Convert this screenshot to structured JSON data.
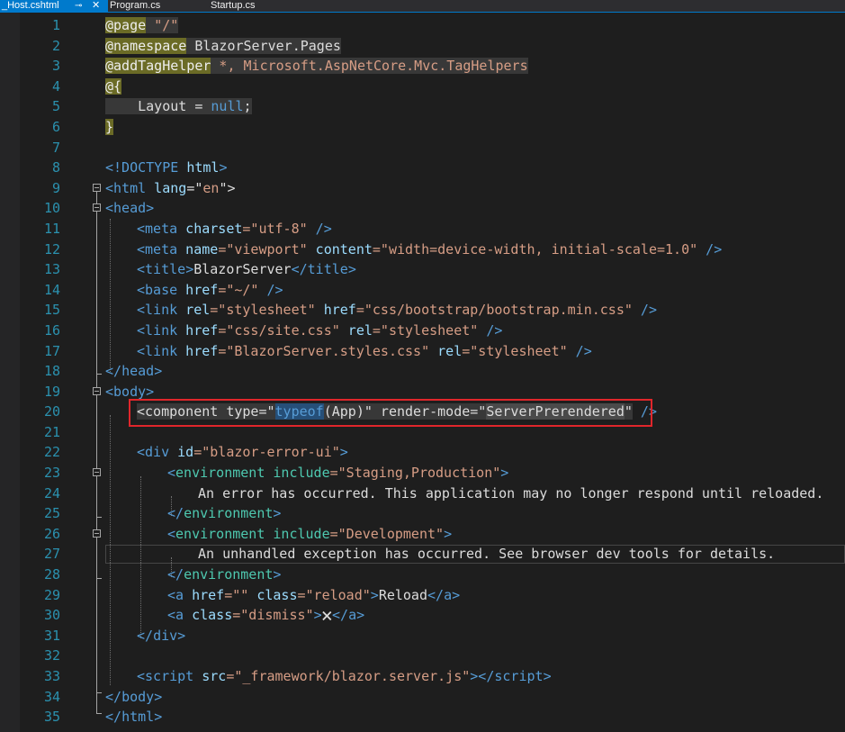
{
  "tabs": [
    {
      "label": "_Host.cshtml",
      "active": true
    },
    {
      "label": "Program.cs",
      "active": false
    },
    {
      "label": "Startup.cs",
      "active": false
    }
  ],
  "icons": {
    "pin": "pin-icon",
    "close": "close-icon"
  },
  "lines": {
    "l1": {
      "n": "1",
      "a": "@page",
      "b": " ",
      "c": "\"/\""
    },
    "l2": {
      "n": "2",
      "a": "@namespace",
      "b": " BlazorServer.Pages"
    },
    "l3": {
      "n": "3",
      "a": "@addTagHelper",
      "b": " *, Microsoft.AspNetCore.Mvc.TagHelpers"
    },
    "l4": {
      "n": "4",
      "a": "@{"
    },
    "l5": {
      "n": "5",
      "a": "    Layout = ",
      "b": "null",
      "c": ";"
    },
    "l6": {
      "n": "6",
      "a": "}"
    },
    "l7": {
      "n": "7"
    },
    "l8": {
      "n": "8",
      "a": "<!DOCTYPE ",
      "b": "html",
      "c": ">"
    },
    "l9": {
      "n": "9",
      "a": "<",
      "b": "html",
      "c": " lang",
      "d": "=\"",
      "e": "en",
      "f": "\">"
    },
    "l10": {
      "n": "10",
      "a": "<",
      "b": "head",
      "c": ">"
    },
    "l11": {
      "n": "11",
      "a": "<",
      "b": "meta",
      "c": " charset",
      "d": "=\"utf-8\"",
      "e": " />"
    },
    "l12": {
      "n": "12",
      "a": "<",
      "b": "meta",
      "c": " name",
      "d": "=\"viewport\"",
      "e": " content",
      "f": "=\"width=device-width, initial-scale=1.0\"",
      "g": " />"
    },
    "l13": {
      "n": "13",
      "a": "<",
      "b": "title",
      "c": ">",
      "d": "BlazorServer",
      "e": "</",
      "f": "title",
      "g": ">"
    },
    "l14": {
      "n": "14",
      "a": "<",
      "b": "base",
      "c": " href",
      "d": "=\"~/\"",
      "e": " />"
    },
    "l15": {
      "n": "15",
      "a": "<",
      "b": "link",
      "c": " rel",
      "d": "=\"stylesheet\"",
      "e": " href",
      "f": "=\"css/bootstrap/bootstrap.min.css\"",
      "g": " />"
    },
    "l16": {
      "n": "16",
      "a": "<",
      "b": "link",
      "c": " href",
      "d": "=\"css/site.css\"",
      "e": " rel",
      "f": "=\"stylesheet\"",
      "g": " />"
    },
    "l17": {
      "n": "17",
      "a": "<",
      "b": "link",
      "c": " href",
      "d": "=\"BlazorServer.styles.css\"",
      "e": " rel",
      "f": "=\"stylesheet\"",
      "g": " />"
    },
    "l18": {
      "n": "18",
      "a": "</",
      "b": "head",
      "c": ">"
    },
    "l19": {
      "n": "19",
      "a": "<",
      "b": "body",
      "c": ">"
    },
    "l20": {
      "n": "20",
      "a": "<",
      "b": "component",
      "c": " type",
      "d": "=\"",
      "e": "typeof",
      "f": "(",
      "g": "App",
      "h": ")",
      "i": "\"",
      "j": " render-mode",
      "k": "=\"",
      "l": "ServerPrerendered",
      "m": "\"",
      "n2": " />"
    },
    "l21": {
      "n": "21"
    },
    "l22": {
      "n": "22",
      "a": "<",
      "b": "div",
      "c": " id",
      "d": "=\"blazor-error-ui\"",
      "e": ">"
    },
    "l23": {
      "n": "23",
      "a": "<",
      "b": "environment",
      "c": " include",
      "d": "=\"Staging,Production\"",
      "e": ">"
    },
    "l24": {
      "n": "24",
      "a": "An error has occurred. This application may no longer respond until reloaded."
    },
    "l25": {
      "n": "25",
      "a": "</",
      "b": "environment",
      "c": ">"
    },
    "l26": {
      "n": "26",
      "a": "<",
      "b": "environment",
      "c": " include",
      "d": "=\"Development\"",
      "e": ">"
    },
    "l27": {
      "n": "27",
      "a": "An unhandled exception has occurred. See browser dev tools for details."
    },
    "l28": {
      "n": "28",
      "a": "</",
      "b": "environment",
      "c": ">"
    },
    "l29": {
      "n": "29",
      "a": "<",
      "b": "a",
      "c": " href",
      "d": "=\"\"",
      "e": " class",
      "f": "=\"reload\"",
      "g": ">",
      "h": "Reload",
      "i": "</",
      "j": "a",
      "k": ">"
    },
    "l30": {
      "n": "30",
      "a": "<",
      "b": "a",
      "c": " class",
      "d": "=\"dismiss\"",
      "e": ">",
      "f": "🗙",
      "g": "</",
      "h": "a",
      "i": ">"
    },
    "l31": {
      "n": "31",
      "a": "</",
      "b": "div",
      "c": ">"
    },
    "l32": {
      "n": "32"
    },
    "l33": {
      "n": "33",
      "a": "<",
      "b": "script",
      "c": " src",
      "d": "=\"_framework/blazor.server.js\"",
      "e": "></",
      "f": "script",
      "g": ">"
    },
    "l34": {
      "n": "34",
      "a": "</",
      "b": "body",
      "c": ">"
    },
    "l35": {
      "n": "35",
      "a": "</",
      "b": "html",
      "c": ">"
    }
  },
  "colors": {
    "editor_bg": "#1e1e1e",
    "line_number": "#2b91af",
    "tag": "#569cd6",
    "attribute": "#9cdcfe",
    "string": "#d69d85",
    "razor_bg": "#6b6b26",
    "highlight_box": "#e0262b",
    "active_tab": "#007acc"
  }
}
